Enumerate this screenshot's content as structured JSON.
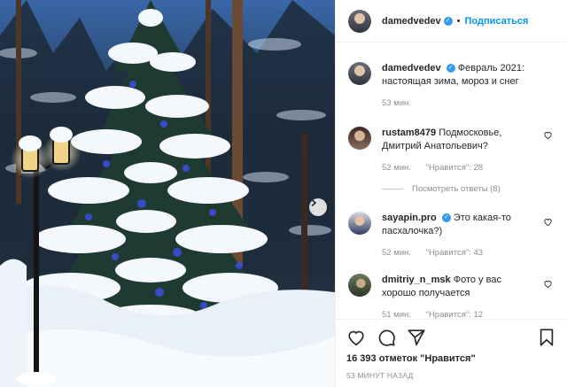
{
  "post": {
    "author": "damedvedev",
    "follow_label": "Подписаться",
    "separator": "•"
  },
  "caption": {
    "author": "damedvedev",
    "text": "Февраль 2021: настоящая зима, мороз и снег",
    "time": "53 мин."
  },
  "comments": [
    {
      "author": "rustam8479",
      "text": "Подмосковье, Дмитрий Анатольевич?",
      "time": "52 мин.",
      "likes": "\"Нравится\": 28",
      "verified": false
    },
    {
      "author": "sayapin.pro",
      "text": "Это какая-то пасхалочка?)",
      "time": "52 мин.",
      "likes": "\"Нравится\": 43",
      "verified": true
    },
    {
      "author": "dmitriy_n_msk",
      "text": "Фото у вас хорошо получается",
      "time": "51 мин.",
      "likes": "\"Нравится\": 12",
      "verified": false
    }
  ],
  "view_replies": "Посмотреть ответы (8)",
  "footer": {
    "likes": "16 393 отметок \"Нравится\"",
    "posted": "53 МИНУТ НАЗАД"
  },
  "icons": [
    "heart-icon",
    "comment-icon",
    "share-icon",
    "bookmark-icon",
    "verified-icon",
    "chevron-right-icon"
  ]
}
